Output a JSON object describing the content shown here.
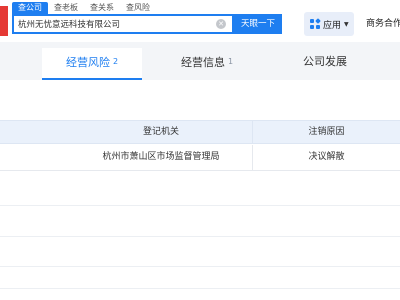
{
  "colors": {
    "accent": "#1e7ef0",
    "brand_red": "#e53935",
    "table_header_bg": "#eaf1fb",
    "tabbar_bg": "#f3f5f8"
  },
  "search": {
    "tabs": [
      "查公司",
      "查老板",
      "查关系",
      "查风险"
    ],
    "value": "杭州无忧意远科技有限公司",
    "button_label": "天眼一下"
  },
  "header": {
    "apps_label": "应用",
    "biz_label": "商务合作"
  },
  "tabs": [
    {
      "label": "经营风险",
      "count": "2"
    },
    {
      "label": "经营信息",
      "count": "1"
    },
    {
      "label": "公司发展",
      "count": ""
    }
  ],
  "table": {
    "headers": {
      "authority": "登记机关",
      "reason": "注销原因"
    },
    "rows": [
      {
        "authority": "杭州市萧山区市场监督管理局",
        "reason": "决议解散"
      }
    ]
  }
}
